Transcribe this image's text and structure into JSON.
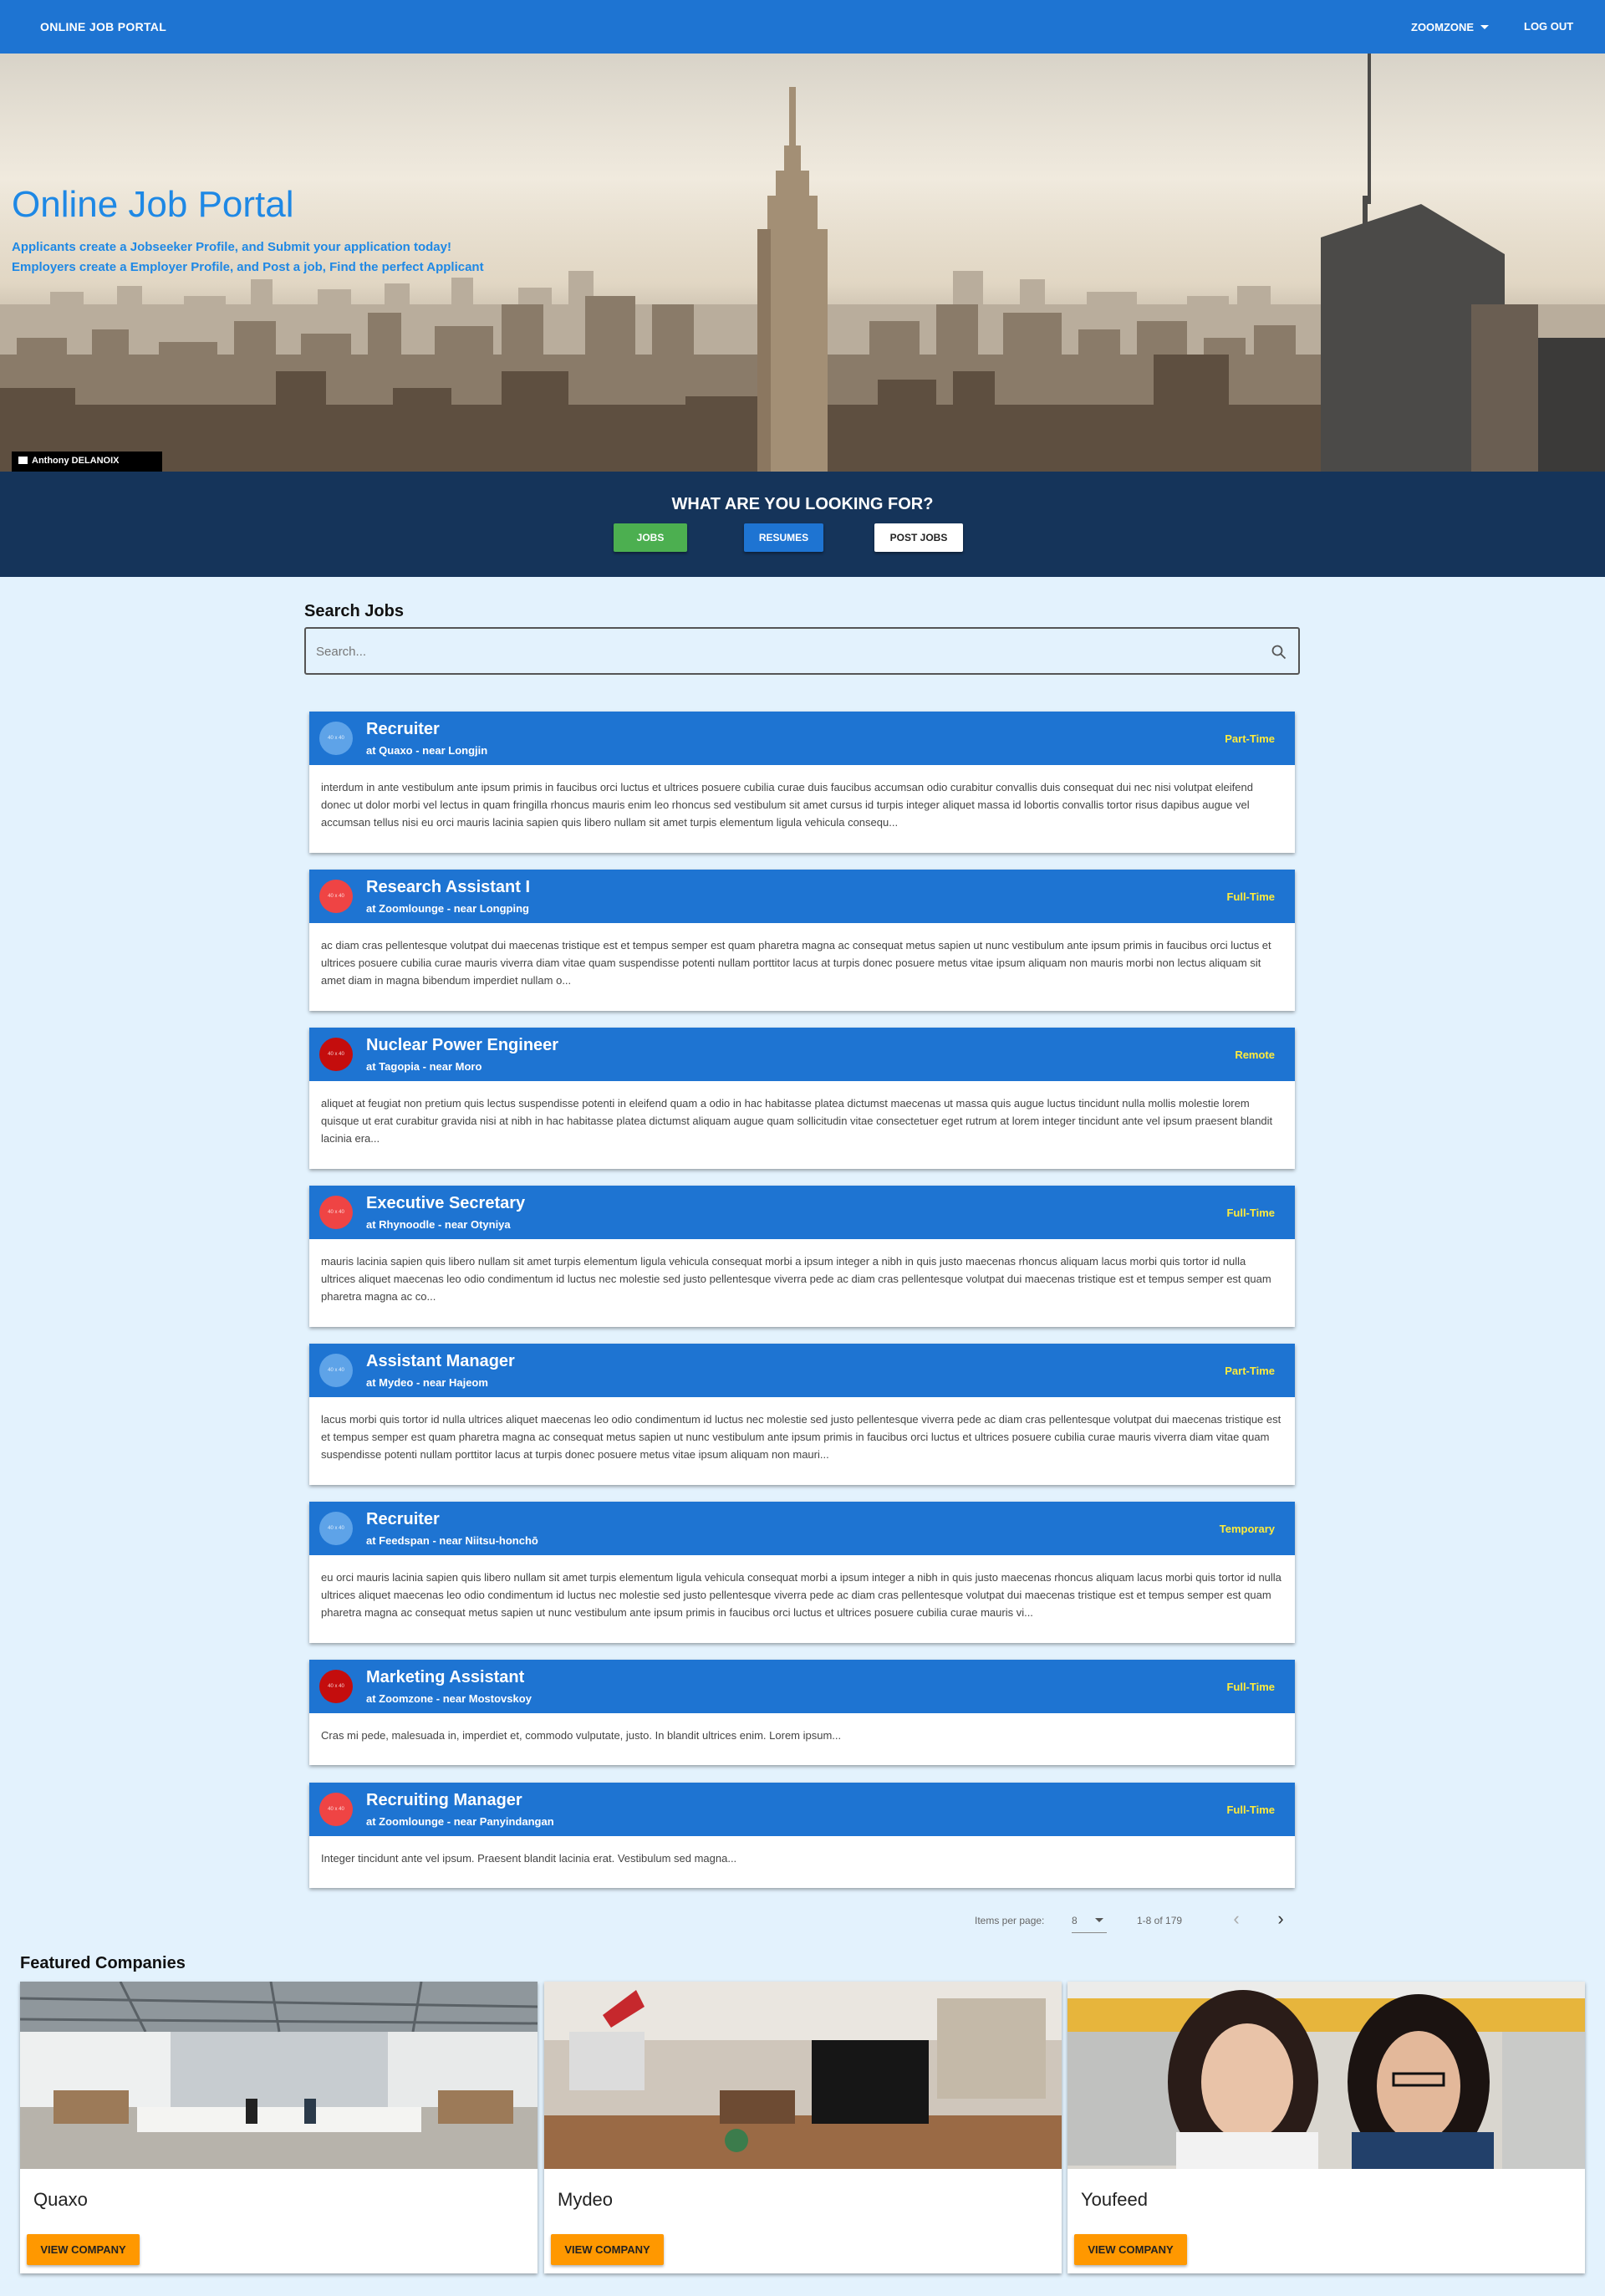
{
  "navbar": {
    "brand": "ONLINE JOB PORTAL",
    "user_menu": "ZOOMZONE",
    "logout": "LOG OUT",
    "color": "#1e74d2"
  },
  "hero": {
    "title": "Online Job Portal",
    "line1": "Applicants create a Jobseeker Profile, and Submit your application today!",
    "line2": "Employers create a Employer Profile, and Post a job, Find the perfect Applicant",
    "photo_credit": "Anthony DELANOIX"
  },
  "looking_for": {
    "question": "WHAT ARE YOU LOOKING FOR?",
    "jobs": "JOBS",
    "resumes": "RESUMES",
    "post_jobs": "POST JOBS"
  },
  "search": {
    "title": "Search Jobs",
    "placeholder": "Search..."
  },
  "jobs": [
    {
      "title": "Recruiter",
      "company": "at Quaxo - near Longjin",
      "type": "Part-Time",
      "logo_color": "#5ea3e8",
      "description": "interdum in ante vestibulum ante ipsum primis in faucibus orci luctus et ultrices posuere cubilia curae duis faucibus accumsan odio curabitur convallis duis consequat dui nec nisi volutpat eleifend donec ut dolor morbi vel lectus in quam fringilla rhoncus mauris enim leo rhoncus sed vestibulum sit amet cursus id turpis integer aliquet massa id lobortis convallis tortor risus dapibus augue vel accumsan tellus nisi eu orci mauris lacinia sapien quis libero nullam sit amet turpis elementum ligula vehicula consequ..."
    },
    {
      "title": "Research Assistant I",
      "company": "at Zoomlounge - near Longping",
      "type": "Full-Time",
      "logo_color": "#ef4444",
      "description": "ac diam cras pellentesque volutpat dui maecenas tristique est et tempus semper est quam pharetra magna ac consequat metus sapien ut nunc vestibulum ante ipsum primis in faucibus orci luctus et ultrices posuere cubilia curae mauris viverra diam vitae quam suspendisse potenti nullam porttitor lacus at turpis donec posuere metus vitae ipsum aliquam non mauris morbi non lectus aliquam sit amet diam in magna bibendum imperdiet nullam o..."
    },
    {
      "title": "Nuclear Power Engineer",
      "company": "at Tagopia - near Moro",
      "type": "Remote",
      "logo_color": "#c40d0d",
      "description": "aliquet at feugiat non pretium quis lectus suspendisse potenti in eleifend quam a odio in hac habitasse platea dictumst maecenas ut massa quis augue luctus tincidunt nulla mollis molestie lorem quisque ut erat curabitur gravida nisi at nibh in hac habitasse platea dictumst aliquam augue quam sollicitudin vitae consectetuer eget rutrum at lorem integer tincidunt ante vel ipsum praesent blandit lacinia era..."
    },
    {
      "title": "Executive Secretary",
      "company": "at Rhynoodle - near Otyniya",
      "type": "Full-Time",
      "logo_color": "#ef4444",
      "description": "mauris lacinia sapien quis libero nullam sit amet turpis elementum ligula vehicula consequat morbi a ipsum integer a nibh in quis justo maecenas rhoncus aliquam lacus morbi quis tortor id nulla ultrices aliquet maecenas leo odio condimentum id luctus nec molestie sed justo pellentesque viverra pede ac diam cras pellentesque volutpat dui maecenas tristique est et tempus semper est quam pharetra magna ac co..."
    },
    {
      "title": "Assistant Manager",
      "company": "at Mydeo - near Hajeom",
      "type": "Part-Time",
      "logo_color": "#5ea3e8",
      "description": "lacus morbi quis tortor id nulla ultrices aliquet maecenas leo odio condimentum id luctus nec molestie sed justo pellentesque viverra pede ac diam cras pellentesque volutpat dui maecenas tristique est et tempus semper est quam pharetra magna ac consequat metus sapien ut nunc vestibulum ante ipsum primis in faucibus orci luctus et ultrices posuere cubilia curae mauris viverra diam vitae quam suspendisse potenti nullam porttitor lacus at turpis donec posuere metus vitae ipsum aliquam non mauri..."
    },
    {
      "title": "Recruiter",
      "company": "at Feedspan - near Niitsu-honchō",
      "type": "Temporary",
      "logo_color": "#5ea3e8",
      "description": "eu orci mauris lacinia sapien quis libero nullam sit amet turpis elementum ligula vehicula consequat morbi a ipsum integer a nibh in quis justo maecenas rhoncus aliquam lacus morbi quis tortor id nulla ultrices aliquet maecenas leo odio condimentum id luctus nec molestie sed justo pellentesque viverra pede ac diam cras pellentesque volutpat dui maecenas tristique est et tempus semper est quam pharetra magna ac consequat metus sapien ut nunc vestibulum ante ipsum primis in faucibus orci luctus et ultrices posuere cubilia curae mauris vi..."
    },
    {
      "title": "Marketing Assistant",
      "company": "at Zoomzone - near Mostovskoy",
      "type": "Full-Time",
      "logo_color": "#c40d0d",
      "description": "Cras mi pede, malesuada in, imperdiet et, commodo vulputate, justo. In blandit ultrices enim. Lorem ipsum..."
    },
    {
      "title": "Recruiting Manager",
      "company": "at Zoomlounge - near Panyindangan",
      "type": "Full-Time",
      "logo_color": "#ef4444",
      "description": "Integer tincidunt ante vel ipsum. Praesent blandit lacinia erat. Vestibulum sed magna..."
    }
  ],
  "paginator": {
    "label": "Items per page:",
    "page_size": "8",
    "range": "1-8 of 179"
  },
  "featured": {
    "title": "Featured Companies",
    "companies": [
      {
        "name": "Quaxo",
        "button": "VIEW COMPANY"
      },
      {
        "name": "Mydeo",
        "button": "VIEW COMPANY"
      },
      {
        "name": "Youfeed",
        "button": "VIEW COMPANY"
      }
    ]
  }
}
